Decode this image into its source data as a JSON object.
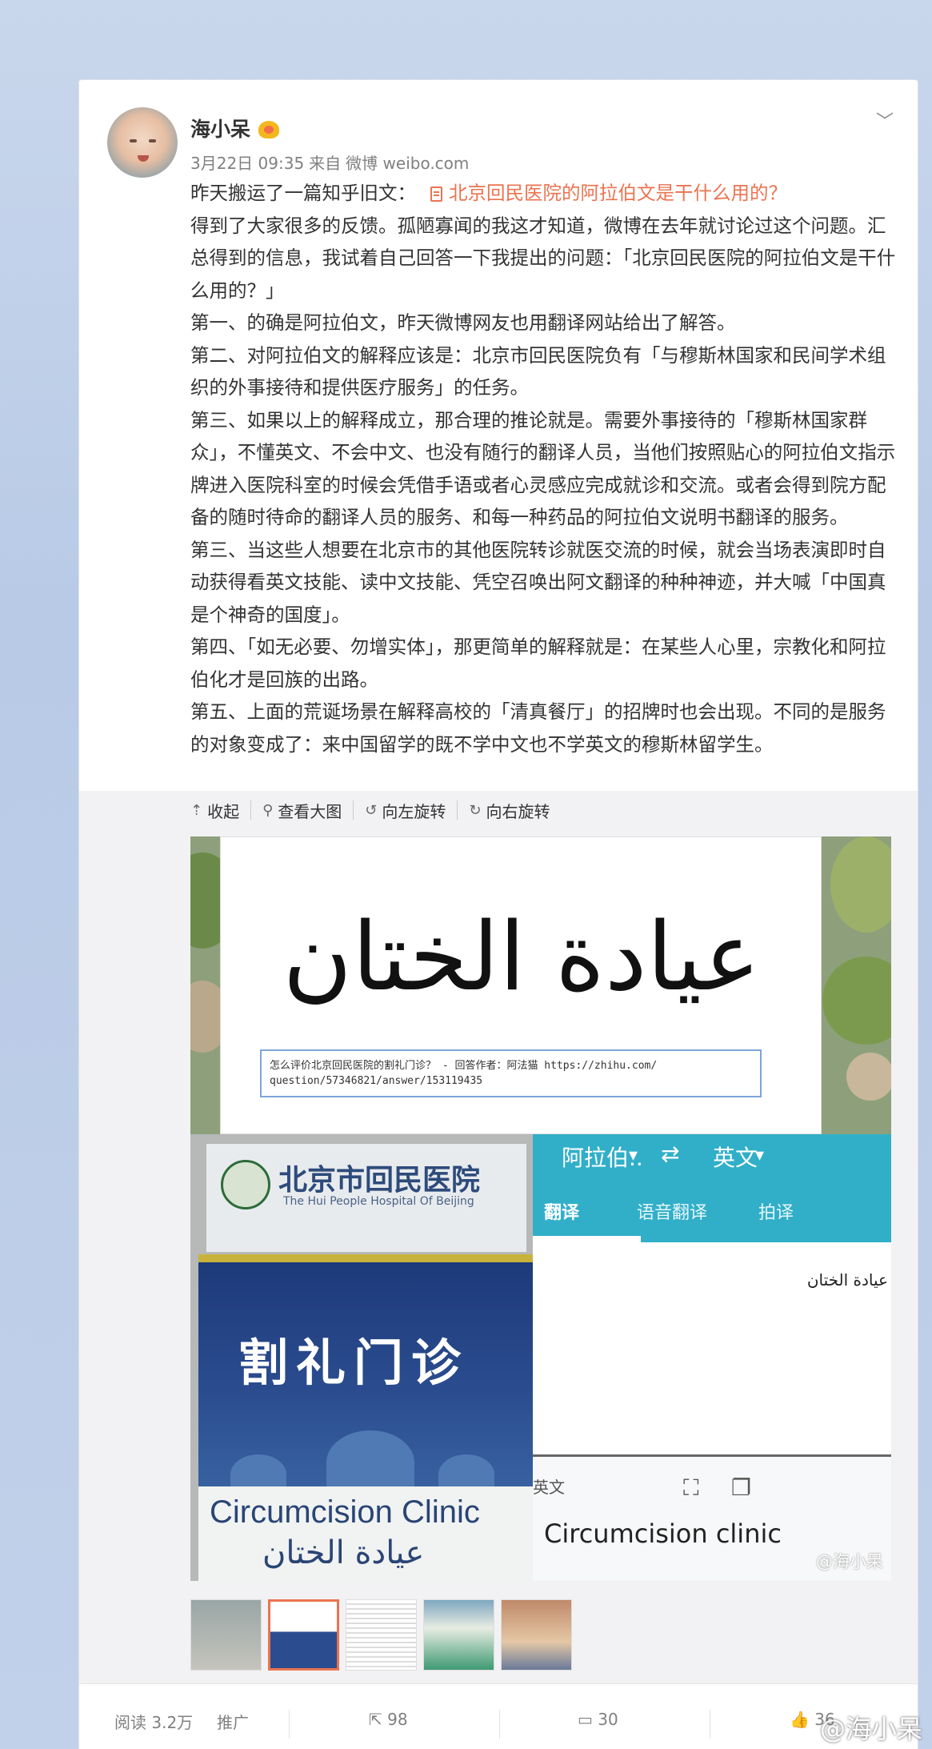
{
  "post": {
    "username": "海小呆",
    "time": "3月22日 09:35",
    "source_prefix": "来自",
    "source": "微博 weibo.com",
    "intro": "昨天搬运了一篇知乎旧文：",
    "link_text": "北京回民医院的阿拉伯文是干什么用的？",
    "paragraphs": [
      "得到了大家很多的反馈。孤陋寡闻的我这才知道，微博在去年就讨论过这个问题。汇总得到的信息，我试着自己回答一下我提出的问题：「北京回民医院的阿拉伯文是干什么用的？」",
      "第一、的确是阿拉伯文，昨天微博网友也用翻译网站给出了解答。",
      "第二、对阿拉伯文的解释应该是：北京市回民医院负有「与穆斯林国家和民间学术组织的外事接待和提供医疗服务」的任务。",
      "第三、如果以上的解释成立，那合理的推论就是。需要外事接待的「穆斯林国家群众」，不懂英文、不会中文、也没有随行的翻译人员，当他们按照贴心的阿拉伯文指示牌进入医院科室的时候会凭借手语或者心灵感应完成就诊和交流。或者会得到院方配备的随时待命的翻译人员的服务、和每一种药品的阿拉伯文说明书翻译的服务。",
      "第三、当这些人想要在北京市的其他医院转诊就医交流的时候，就会当场表演即时自动获得看英文技能、读中文技能、凭空召唤出阿文翻译的种种神迹，并大喊「中国真是个神奇的国度」。",
      "第四、「如无必要、勿增实体」，那更简单的解释就是：在某些人心里，宗教化和阿拉伯化才是回族的出路。",
      "第五、上面的荒诞场景在解释高校的「清真餐厅」的招牌时也会出现。不同的是服务的对象变成了：来中国留学的既不学中文也不学英文的穆斯林留学生。"
    ]
  },
  "toolbar": {
    "collapse": "收起",
    "view_large": "查看大图",
    "rotate_left": "向左旋转",
    "rotate_right": "向右旋转"
  },
  "image": {
    "arabic": "عيادة الختان",
    "caption_line1": "怎么评价北京回民医院的割礼门诊？ - 回答作者：阿法猫 https://zhihu.com/",
    "caption_line2": "question/57346821/answer/153119435",
    "hospital_cn": "北京市回民医院",
    "hospital_en": "The Hui People Hospital Of Beijing",
    "clinic_cn": "割礼门诊",
    "clinic_en": "Circumcision Clinic",
    "clinic_ar": "عيادة الختان",
    "app_from": "阿拉伯..",
    "app_swap": "⇄",
    "app_to": "英文",
    "app_tab1": "翻译",
    "app_tab2": "语音翻译",
    "app_tab3": "拍译",
    "app_input": "عيادة الختان",
    "app_label": "英文",
    "app_output": "Circumcision clinic",
    "watermark": "@海小呆"
  },
  "footer": {
    "read_label": "阅读",
    "read_count": "3.2万",
    "promote": "推广",
    "share_count": "98",
    "comment_count": "30",
    "like_count": "36"
  },
  "page_watermark": "@海小呆"
}
